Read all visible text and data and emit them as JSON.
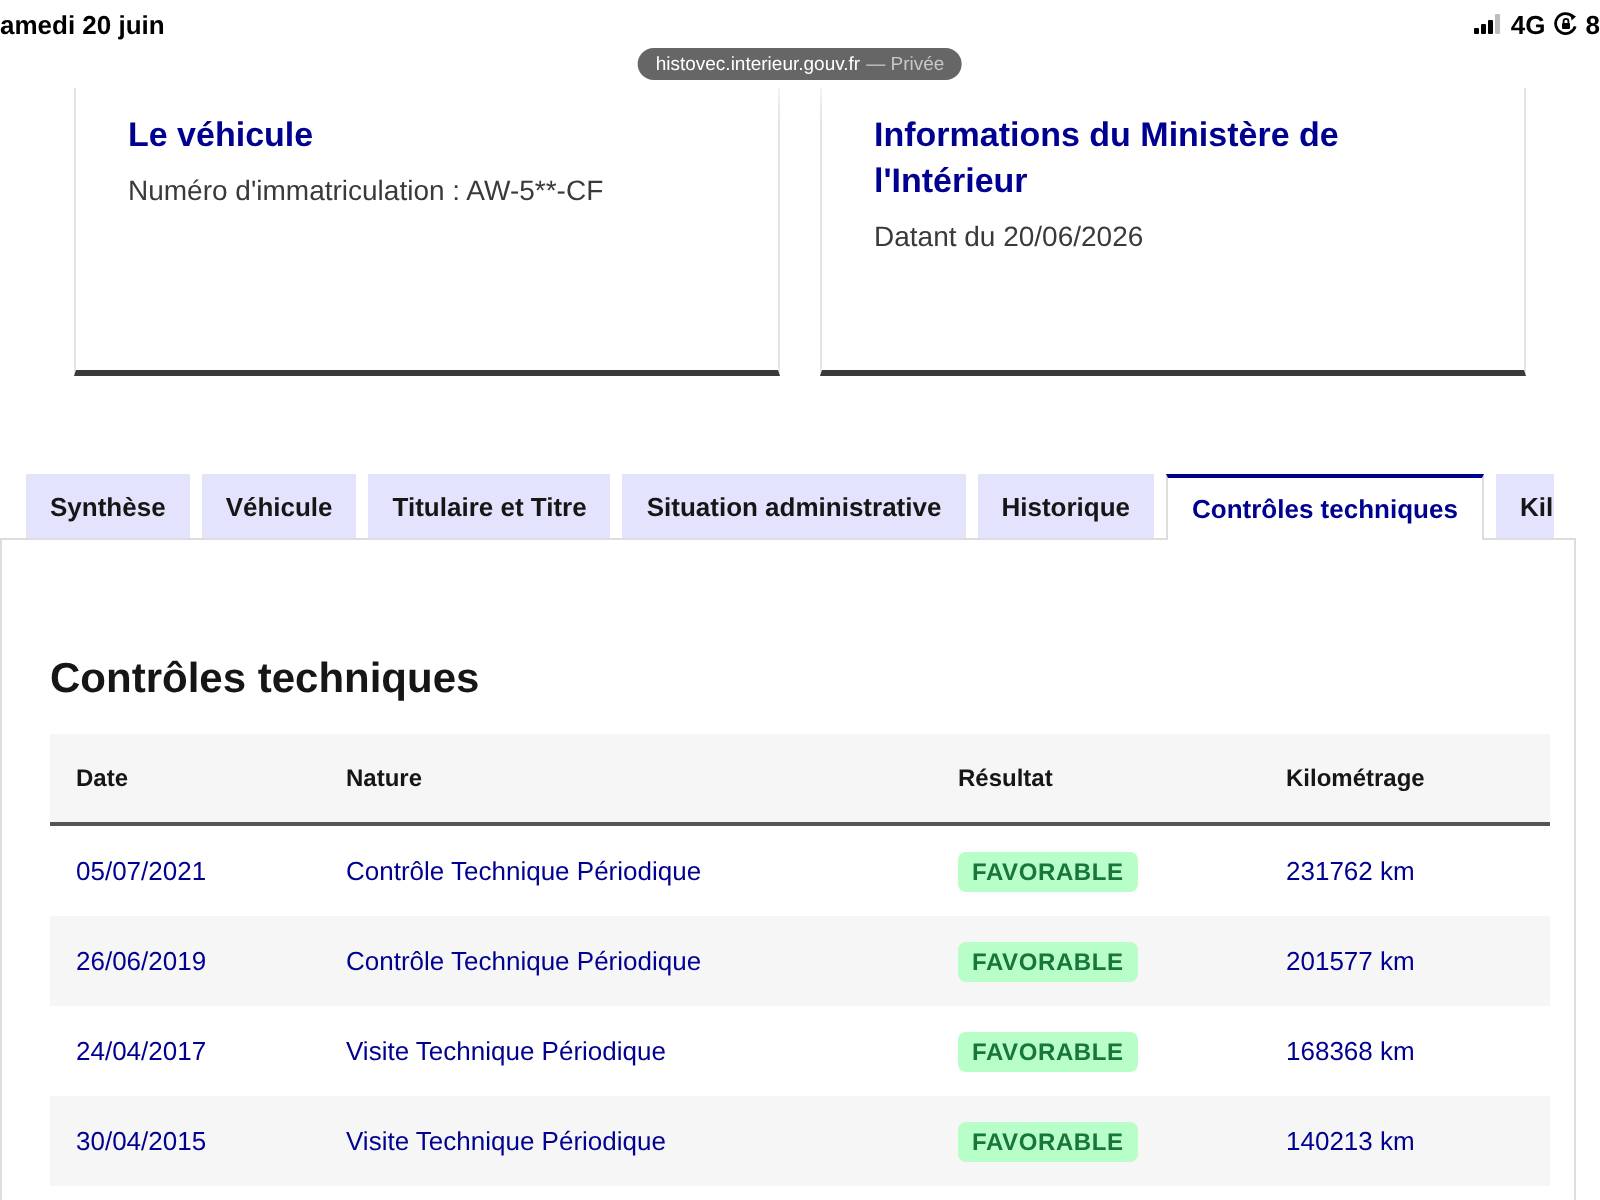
{
  "status_bar": {
    "date": "amedi 20 juin",
    "network": "4G",
    "battery": "8"
  },
  "address_bar": {
    "domain": "histovec.interieur.gouv.fr",
    "mode": "— Privée"
  },
  "cards": [
    {
      "title": "Le véhicule",
      "text": "Numéro d'immatriculation : AW-5**-CF"
    },
    {
      "title": "Informations du Ministère de l'Intérieur",
      "text": "Datant du 20/06/2026"
    }
  ],
  "tabs": [
    {
      "label": "Synthèse",
      "selected": false
    },
    {
      "label": "Véhicule",
      "selected": false
    },
    {
      "label": "Titulaire et Titre",
      "selected": false
    },
    {
      "label": "Situation administrative",
      "selected": false
    },
    {
      "label": "Historique",
      "selected": false
    },
    {
      "label": "Contrôles techniques",
      "selected": true
    },
    {
      "label": "Kil",
      "selected": false
    }
  ],
  "section": {
    "title": "Contrôles techniques"
  },
  "table": {
    "columns": [
      "Date",
      "Nature",
      "Résultat",
      "Kilométrage"
    ],
    "rows": [
      {
        "date": "05/07/2021",
        "nature": "Contrôle Technique Périodique",
        "result": "FAVORABLE",
        "mileage": "231762 km"
      },
      {
        "date": "26/06/2019",
        "nature": "Contrôle Technique Périodique",
        "result": "FAVORABLE",
        "mileage": "201577 km"
      },
      {
        "date": "24/04/2017",
        "nature": "Visite Technique Périodique",
        "result": "FAVORABLE",
        "mileage": "168368 km"
      },
      {
        "date": "30/04/2015",
        "nature": "Visite Technique Périodique",
        "result": "FAVORABLE",
        "mileage": "140213 km"
      }
    ]
  }
}
